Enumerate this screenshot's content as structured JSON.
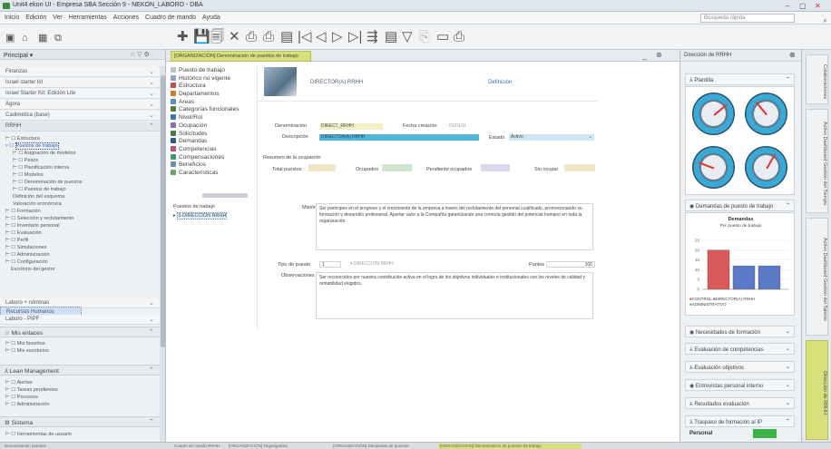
{
  "title_bar": {
    "title": "Unit4 ekon UI - Empresa SBA Sección 9 - NEKON_LABORO - DBA",
    "min": "–",
    "max": "▢",
    "close": "✕"
  },
  "menu": {
    "items": [
      "Inicio",
      "Edición",
      "Ver",
      "Herramientas",
      "Acciones",
      "Cuadro de mando",
      "Ayuda"
    ],
    "search_placeholder": "Búsqueda rápida"
  },
  "toolbar": {
    "icons": [
      "✚",
      "💾",
      "🗐",
      "✕",
      "⎙",
      "⎙",
      "▤",
      "|◁",
      "◁",
      "▷",
      "▷|",
      "⇶",
      "▤",
      "▽",
      "⎘",
      "▭",
      "⎙"
    ]
  },
  "left": {
    "header": "Principal",
    "modules": [
      "Finanzas",
      "Israel starter kit",
      "Israel Starter Kit: Edición Lite",
      "Ágora",
      "Cadimetica (base)",
      "RRHH"
    ],
    "tree": [
      "Estructura",
      "Puestos de trabajo",
      "Asignación de modelos",
      "Pesos",
      "Planificación Interna",
      "Modelos",
      "Denominación de puestos",
      "Puestos de trabajo",
      "Definición del esquema",
      "Valoración económica",
      "Formación",
      "Selección y reclutamiento",
      "Inventario personal",
      "Evaluación",
      "Perfil",
      "Simulaciones",
      "Administración",
      "Configuración",
      "Escritorio del gestor"
    ],
    "extra": [
      "Laboro + nóminas",
      "Recursos Humanos",
      "Laboro - PIPF"
    ],
    "sections": [
      {
        "title": "Mis enlaces",
        "items": [
          "Mis favoritos",
          "Mis escritorios"
        ]
      },
      {
        "title": "Lean Management",
        "items": [
          "Alertas",
          "Tareas pendientes",
          "Procesos",
          "Administración"
        ]
      },
      {
        "title": "Sistema",
        "items": [
          "Herramientas de usuario"
        ]
      }
    ]
  },
  "center": {
    "tab": "[ORGANIZACIÓN] Denominación de puestos de trabajo",
    "tab_controls": [
      "_",
      "⊗"
    ],
    "nav_items": [
      "Puesto de trabajo",
      "Histórico no vigente",
      "Estructura",
      "Departamentos",
      "Áreas",
      "Categorías funcionales",
      "Nivel/Rol",
      "Ocupación",
      "Solicitudes",
      "Demandas",
      "Competencias",
      "Compensaciones",
      "Beneficios",
      "Características"
    ],
    "puestos_title": "Puestos de trabajo",
    "puestos_item": "3-DIRECCIÓN RRHH",
    "header_code": "DIRECTOR(A) RRHH",
    "definicion": "Definición",
    "denominacion_lbl": "Denominación",
    "denominacion_val": "DIRECT_RRHH",
    "fecha_lbl": "Fecha creación",
    "fecha_val": "01/01/11",
    "descripcion_lbl": "Descripción",
    "descripcion_val": "DIRECTOR(A) RRHH",
    "estado_lbl": "Estado",
    "estado_val": "Activo",
    "resumen_title": "Resumen de la ocupación",
    "total_lbl": "Total puestos",
    "ocupados_lbl": "Ocupados",
    "pend_lbl": "Pendiente ocupados",
    "sin_lbl": "Sin ocupar",
    "mision_lbl": "Misión",
    "mision_txt": "Ser partícipes en el progreso y el crecimiento de la empresa a través del reclutamiento del personal cualificado, promocionando su formación y desarrollo profesional. Aportar valor a la Compañía garantizando una correcta gestión del potencial humano en toda la organización.",
    "tipo_lbl": "Tipo de puesto",
    "tipo_val": "1",
    "tipo_desc": "DIRECCIÓN RRHH",
    "puntos_lbl": "Puntos",
    "puntos_val": "100",
    "obs_lbl": "Observaciones",
    "obs_txt": "Ser reconocidos por nuestra contribución activa en el logro de los objetivos individuales e institucionales con los niveles de calidad y rentabilidad exigidos."
  },
  "right": {
    "header": "Dirección de RRHH",
    "plantilla": "Plantilla",
    "demandas": "Demandas de puesto de trabajo",
    "chart_title": "Demandas",
    "chart_sub": "Por puesto de trabajo",
    "legend": [
      "CONTROL",
      "DIRECTOR(A) RRHH",
      "ADMINISTRATIVO"
    ],
    "rows": [
      "Necesidades de formación",
      "Evaluación de competencias",
      "Evaluación objetivos",
      "Entrevistas personal interno",
      "Resultados evaluación",
      "Traspaso de formación al IP"
    ],
    "personal": "Personal"
  },
  "chart_data": {
    "type": "bar",
    "title": "Demandas",
    "subtitle": "Por puesto de trabajo",
    "categories": [
      "CONTROL",
      "DIRECTOR(A) RRHH",
      "ADMINISTRATIVO"
    ],
    "values": [
      20,
      12,
      12
    ],
    "ylim": [
      0,
      25
    ],
    "yticks": [
      0,
      5,
      10,
      15,
      20,
      25
    ]
  },
  "vtabs": [
    "Colaboraciones",
    "Activo Dashboard Gestión del Tiempo",
    "Activo Dashboard Gestión del Talento",
    "Dirección de RRHH"
  ],
  "status": [
    "Denominación puestos",
    "Cuadro de mando RRHH",
    "[ORGANIZACIÓN] Organigrama",
    "[ORGANIZACIÓN] Demandas de puestos",
    "[ORGANIZACIÓN] Denominación de puestos",
    "[ORGANIZACIÓN] Denominación de puestos de trabajo"
  ],
  "colors": {
    "accent": "#d7e07a",
    "desc_field": "#4fb8d8",
    "denom_field": "#f2f0c4",
    "chart_red": "#d9585a",
    "chart_blue": "#5c79c7"
  }
}
